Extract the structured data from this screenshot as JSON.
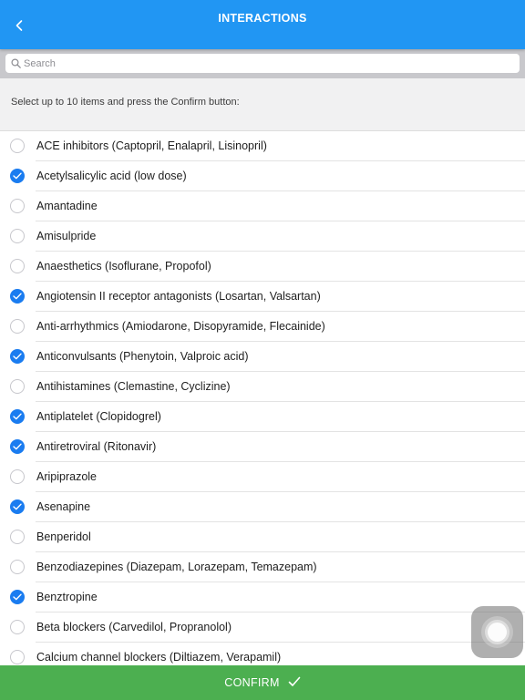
{
  "header": {
    "title": "INTERACTIONS"
  },
  "search": {
    "placeholder": "Search",
    "value": ""
  },
  "instruction": "Select up to 10 items and press the Confirm button:",
  "items": [
    {
      "label": "ACE inhibitors (Captopril, Enalapril, Lisinopril)",
      "checked": false
    },
    {
      "label": "Acetylsalicylic acid (low dose)",
      "checked": true
    },
    {
      "label": "Amantadine",
      "checked": false
    },
    {
      "label": "Amisulpride",
      "checked": false
    },
    {
      "label": "Anaesthetics (Isoflurane, Propofol)",
      "checked": false
    },
    {
      "label": "Angiotensin II receptor antagonists (Losartan, Valsartan)",
      "checked": true
    },
    {
      "label": "Anti-arrhythmics (Amiodarone, Disopyramide, Flecainide)",
      "checked": false
    },
    {
      "label": "Anticonvulsants (Phenytoin, Valproic acid)",
      "checked": true
    },
    {
      "label": "Antihistamines (Clemastine, Cyclizine)",
      "checked": false
    },
    {
      "label": "Antiplatelet (Clopidogrel)",
      "checked": true
    },
    {
      "label": "Antiretroviral (Ritonavir)",
      "checked": true
    },
    {
      "label": "Aripiprazole",
      "checked": false
    },
    {
      "label": "Asenapine",
      "checked": true
    },
    {
      "label": "Benperidol",
      "checked": false
    },
    {
      "label": "Benzodiazepines (Diazepam, Lorazepam, Temazepam)",
      "checked": false
    },
    {
      "label": "Benztropine",
      "checked": true
    },
    {
      "label": "Beta blockers (Carvedilol, Propranolol)",
      "checked": false
    },
    {
      "label": "Calcium channel blockers (Diltiazem, Verapamil)",
      "checked": false
    }
  ],
  "confirm": {
    "label": "CONFIRM",
    "icon": "checkmark-icon"
  },
  "icons": {
    "back": "chevron-left-icon",
    "search": "search-icon",
    "assistive": "assistive-touch-icon"
  },
  "colors": {
    "header": "#2196F3",
    "checked": "#1a7cf0",
    "confirm": "#4caf50"
  }
}
